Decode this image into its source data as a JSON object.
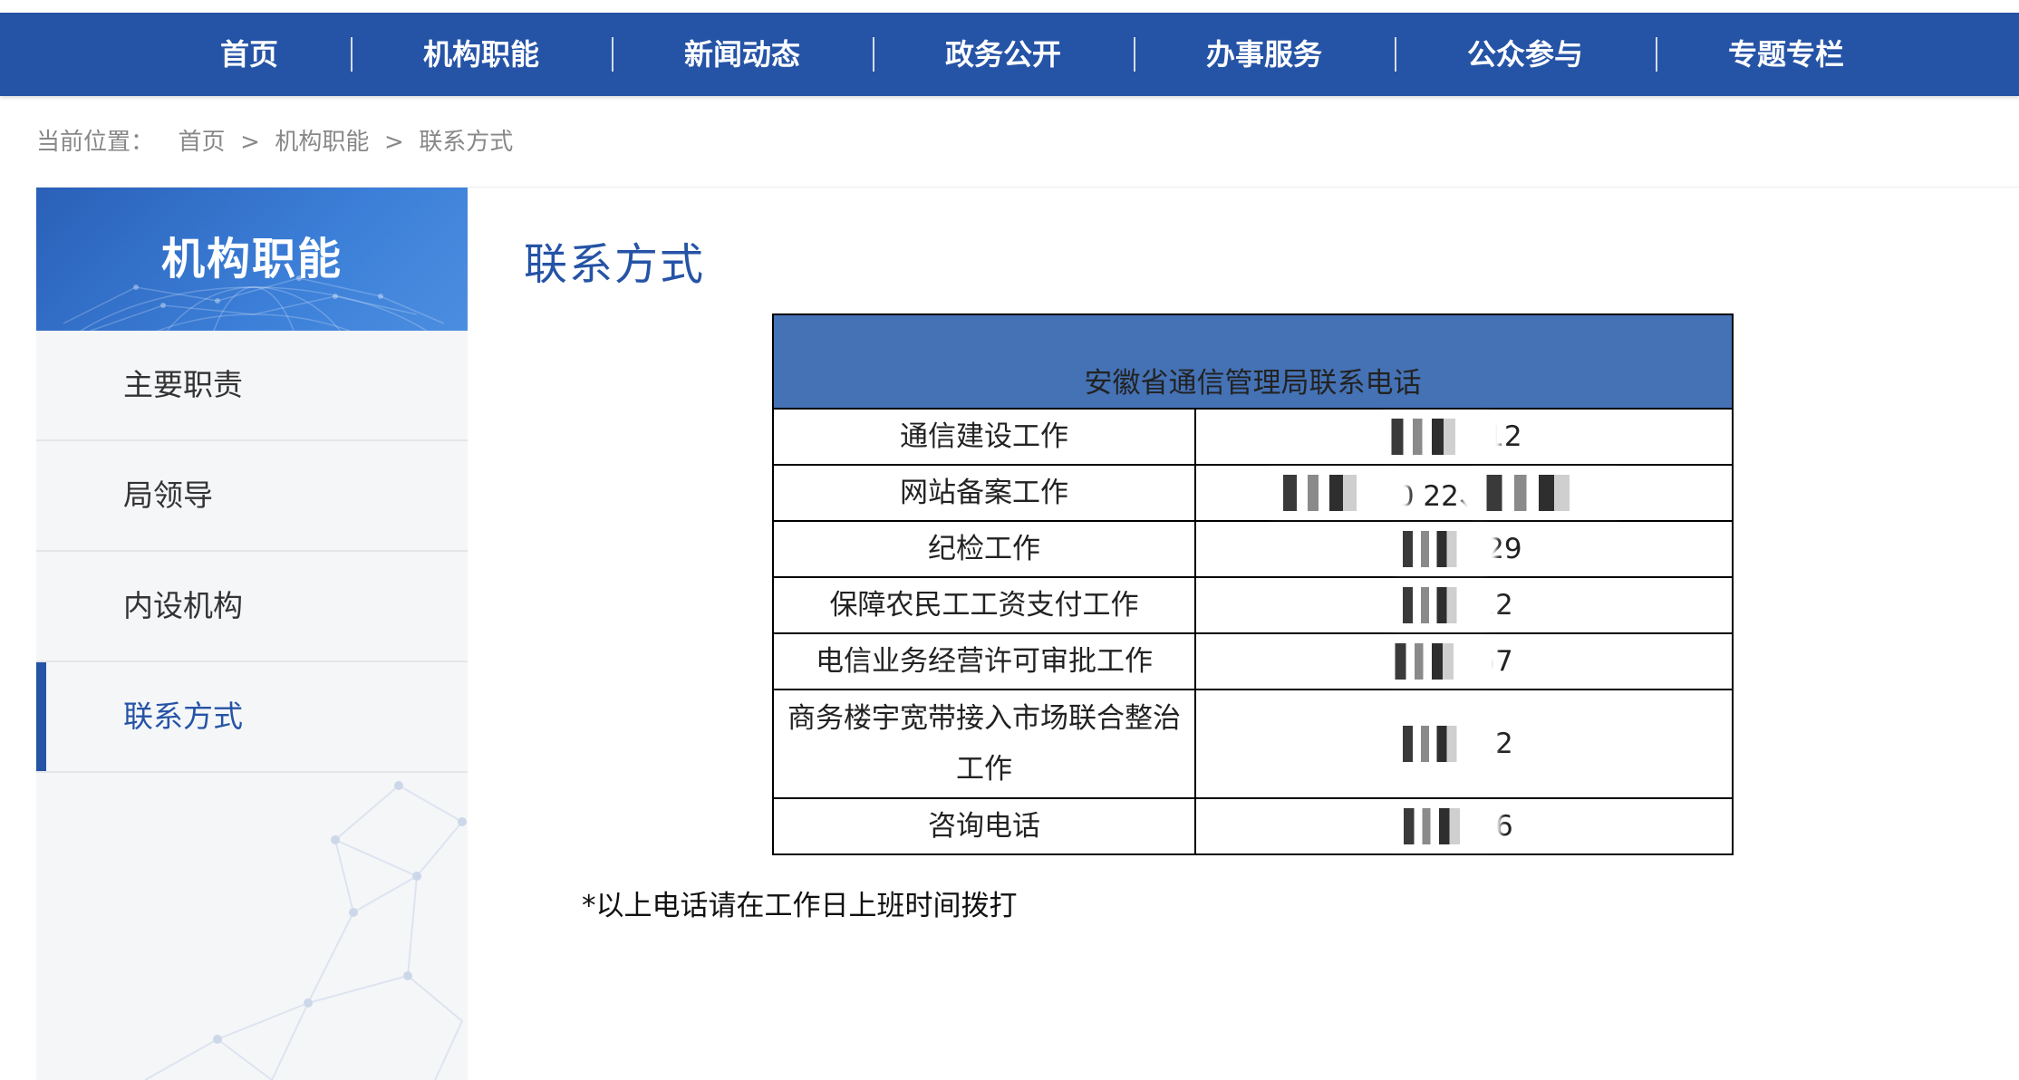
{
  "nav": {
    "items": [
      "首页",
      "机构职能",
      "新闻动态",
      "政务公开",
      "办事服务",
      "公众参与",
      "专题专栏"
    ]
  },
  "breadcrumb": {
    "prefix": "当前位置：",
    "home": "首页",
    "sep1": " > ",
    "level1": "机构职能",
    "sep2": " > ",
    "current": "联系方式"
  },
  "sidebar": {
    "title": "机构职能",
    "items": [
      {
        "label": "主要职责"
      },
      {
        "label": "局领导"
      },
      {
        "label": "内设机构"
      },
      {
        "label": "联系方式",
        "active": true
      }
    ]
  },
  "content": {
    "title": "联系方式",
    "table_title": "安徽省通信管理局联系电话",
    "rows": [
      {
        "dept": "通信建设工作",
        "phone_visible": "05 0712"
      },
      {
        "dept": "网站备案工作",
        "phone_visible": "0 22、 18"
      },
      {
        "dept": "纪检工作",
        "phone_visible": "05 0729"
      },
      {
        "dept": "保障农民工工资支付工作",
        "phone_visible": "05 712"
      },
      {
        "dept": "电信业务经营许可审批工作",
        "phone_visible": "05 867"
      },
      {
        "dept": "商务楼宇宽带接入市场联合整治工作",
        "phone_visible": "05 712"
      },
      {
        "dept": "咨询电话",
        "phone_visible": "05 866"
      }
    ],
    "note": "*以上电话请在工作日上班时间拨打"
  },
  "colors": {
    "nav_bg": "#2553a6",
    "accent": "#2553a6",
    "table_header_bg": "#4572b5",
    "sidebar_bg": "#f5f6f8"
  }
}
